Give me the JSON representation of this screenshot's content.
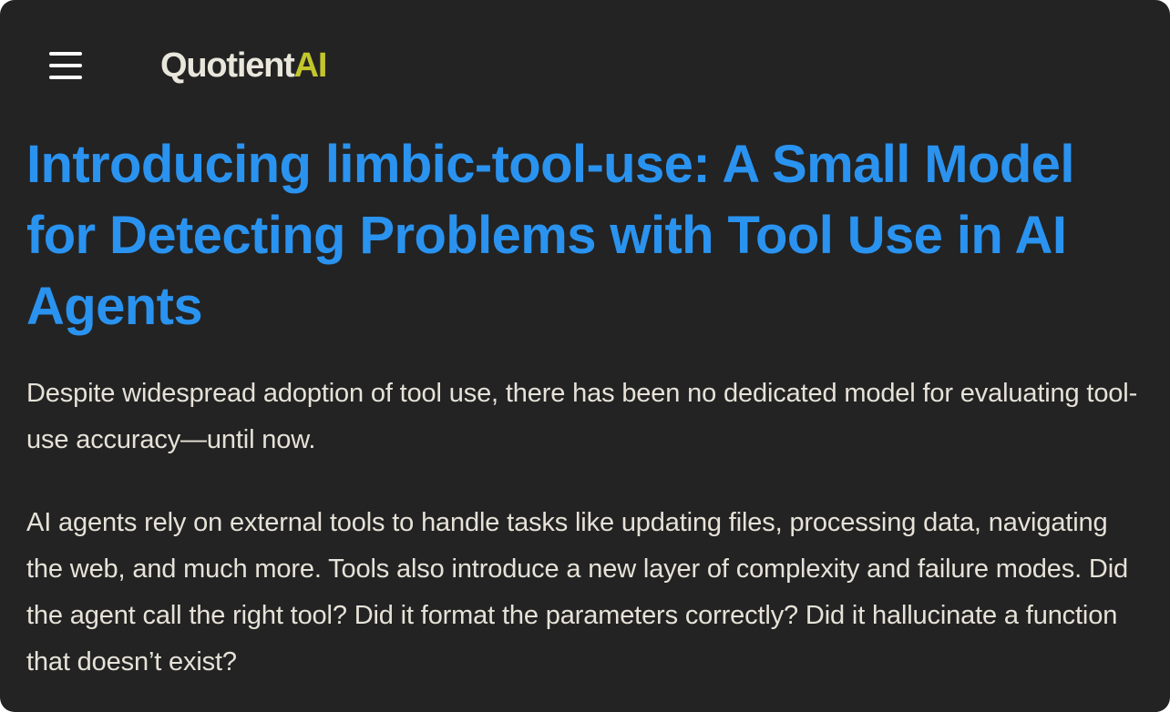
{
  "header": {
    "menu_icon": "hamburger-menu-icon",
    "logo": {
      "wordmark": "Quotient",
      "accent": "AI"
    }
  },
  "article": {
    "title": "Introducing limbic-tool-use: A Small Model for Detecting Problems with Tool Use in AI Agents",
    "paragraphs": [
      "Despite widespread adoption of tool use, there has been no dedicated model for evaluating tool-use accuracy—until now.",
      "AI agents rely on external tools to handle tasks like updating files, processing data, navigating the web, and much more. Tools also introduce a new layer of complexity and failure modes. Did the agent call the right tool? Did it format the parameters correctly? Did it hallucinate a function that doesn’t exist?"
    ]
  },
  "colors": {
    "background": "#232323",
    "title": "#2a93f0",
    "body_text": "#e6e2d8",
    "logo_text": "#e9e6dc",
    "logo_accent": "#c2c62a"
  }
}
